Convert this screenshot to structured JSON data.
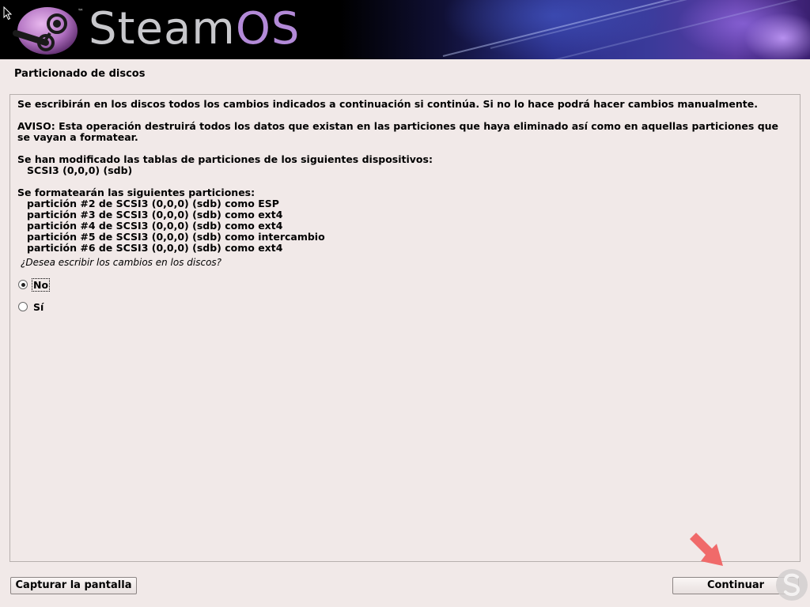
{
  "banner": {
    "brand_prefix": "Steam",
    "brand_suffix": "OS",
    "trademark": "™"
  },
  "page": {
    "title": "Particionado de discos"
  },
  "content": {
    "line1": "Se escribirán en los discos todos los cambios indicados a continuación si continúa. Si no lo hace podrá hacer cambios manualmente.",
    "warning_line1": "AVISO: Esta operación destruirá todos los datos que existan en las particiones que haya eliminado así como en aquellas particiones que",
    "warning_line2": "se vayan a formatear.",
    "modified_heading": "Se han modificado las tablas de particiones de los siguientes dispositivos:",
    "modified_device": "SCSI3 (0,0,0) (sdb)",
    "format_heading": "Se formatearán las siguientes particiones:",
    "partitions": [
      "partición #2 de SCSI3 (0,0,0) (sdb) como ESP",
      "partición #3 de SCSI3 (0,0,0) (sdb) como ext4",
      "partición #4 de SCSI3 (0,0,0) (sdb) como ext4",
      "partición #5 de SCSI3 (0,0,0) (sdb) como intercambio",
      "partición #6 de SCSI3 (0,0,0) (sdb) como ext4"
    ],
    "question": "¿Desea escribir los cambios en los discos?",
    "options": [
      {
        "label": "No",
        "selected": true
      },
      {
        "label": "Sí",
        "selected": false
      }
    ]
  },
  "buttons": {
    "capture": "Capturar la pantalla",
    "continue": "Continuar"
  },
  "colors": {
    "background": "#f1e9e8",
    "arrow": "#f06a6a",
    "watermark": "#c9c6c6"
  },
  "icons": [
    "steam-logo-icon",
    "mouse-cursor-icon",
    "annotation-arrow-icon",
    "watermark-s-icon"
  ]
}
